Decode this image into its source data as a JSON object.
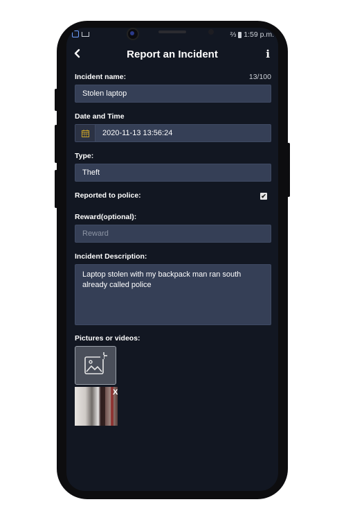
{
  "status_bar": {
    "time": "1:59 p.m.",
    "signal_text": "⅔"
  },
  "header": {
    "title": "Report an Incident",
    "back_icon": "chevron-left-icon",
    "info_label": "i"
  },
  "form": {
    "incident_name": {
      "label": "Incident name:",
      "counter": "13/100",
      "value": "Stolen laptop"
    },
    "date_time": {
      "label": "Date and Time",
      "value": "2020-11-13 13:56:24"
    },
    "type": {
      "label": "Type:",
      "value": "Theft"
    },
    "reported_to_police": {
      "label": "Reported to police:",
      "checked": true,
      "check_glyph": "✔"
    },
    "reward": {
      "label": "Reward(optional):",
      "placeholder": "Reward",
      "value": ""
    },
    "description": {
      "label": "Incident Description:",
      "value": "Laptop stolen with my backpack man ran south already called police"
    },
    "media": {
      "label": "Pictures or videos:",
      "remove_label": "X"
    }
  },
  "colors": {
    "background": "#121722",
    "field": "#353f56",
    "text": "#ffffff",
    "calendar_icon": "#c9a227"
  }
}
